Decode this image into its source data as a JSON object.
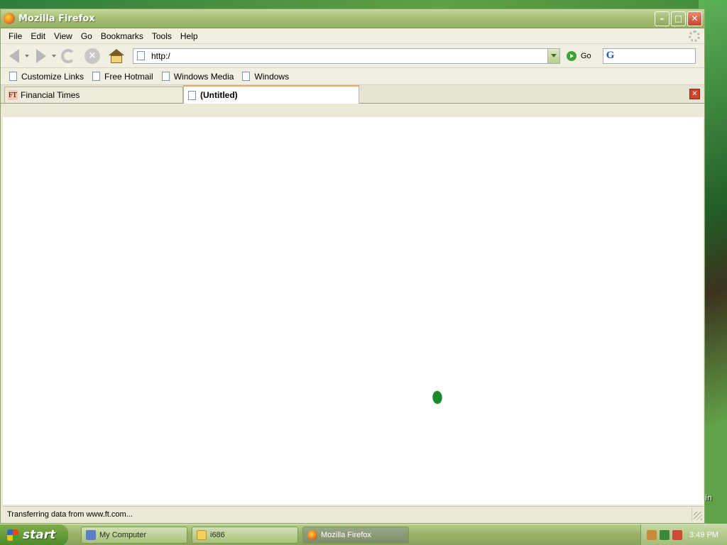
{
  "window": {
    "title": "Mozilla Firefox"
  },
  "menu": [
    "File",
    "Edit",
    "View",
    "Go",
    "Bookmarks",
    "Tools",
    "Help"
  ],
  "toolbar": {
    "url": "http:/",
    "go_label": "Go",
    "search_value": ""
  },
  "bookmarks": [
    "Customize Links",
    "Free Hotmail",
    "Windows Media",
    "Windows"
  ],
  "tabs": [
    {
      "label": "Financial Times",
      "icon": "ft-favicon"
    },
    {
      "label": "(Untitled)",
      "icon": "page-icon",
      "active": true
    }
  ],
  "status": {
    "text": "Transferring data from www.ft.com..."
  },
  "desktop": {
    "partial_label": "in"
  },
  "taskbar": {
    "start_label": "start",
    "tasks": [
      {
        "label": "My Computer",
        "icon": "computer-icon"
      },
      {
        "label": "i686",
        "icon": "folder-icon"
      },
      {
        "label": "Mozilla Firefox",
        "icon": "firefox-icon",
        "active": true
      }
    ],
    "clock": "3:49 PM"
  }
}
